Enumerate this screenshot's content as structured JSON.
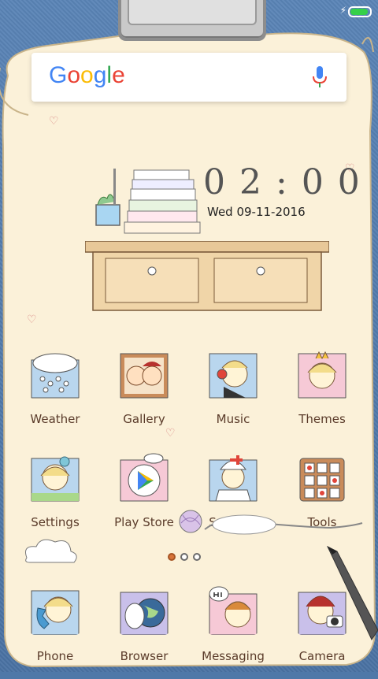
{
  "status": {
    "charging_icon": "bolt-icon",
    "battery_level": 0.9
  },
  "search": {
    "logo": "Google",
    "mic_icon": "mic-icon"
  },
  "clock": {
    "time": "02:00",
    "date": "Wed  09-11-2016"
  },
  "apps": [
    {
      "label": "Weather"
    },
    {
      "label": "Gallery"
    },
    {
      "label": "Music"
    },
    {
      "label": "Themes"
    },
    {
      "label": "Settings"
    },
    {
      "label": "Play Store"
    },
    {
      "label": "Security"
    },
    {
      "label": "Tools"
    },
    {
      "label": "Phone"
    },
    {
      "label": "Browser"
    },
    {
      "label": "Messaging"
    },
    {
      "label": "Camera"
    }
  ],
  "pages": {
    "count": 3,
    "active": 0
  },
  "colors": {
    "paper": "#fbf1d9",
    "denim": "#4f78a8",
    "label": "#5a3b2a",
    "accent": "#d8743a"
  }
}
